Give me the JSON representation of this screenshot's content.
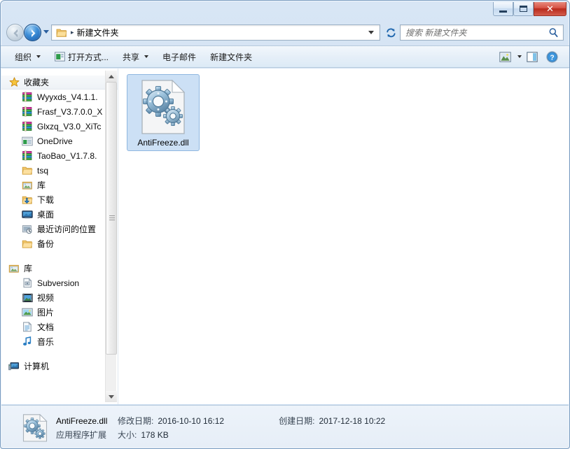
{
  "window": {
    "title": "",
    "controls": {
      "minimize": "minimize-button",
      "maximize": "maximize-button",
      "close": "✕"
    }
  },
  "nav": {
    "back_tooltip": "后退",
    "forward_tooltip": "前进",
    "breadcrumb": "新建文件夹",
    "breadcrumb_separator": "▸",
    "refresh_label": "刷新"
  },
  "search": {
    "placeholder": "搜索 新建文件夹",
    "value": ""
  },
  "toolbar": {
    "items": [
      {
        "label": "组织",
        "icon": "none",
        "caret": true
      },
      {
        "label": "打开方式...",
        "icon": "open-with-icon",
        "caret": false
      },
      {
        "label": "共享",
        "icon": "none",
        "caret": true
      },
      {
        "label": "电子邮件",
        "icon": "none",
        "caret": false
      },
      {
        "label": "新建文件夹",
        "icon": "none",
        "caret": false
      }
    ],
    "right_icons": [
      {
        "name": "view-icon",
        "caret": true
      },
      {
        "name": "preview-pane-icon",
        "caret": false
      },
      {
        "name": "help-icon",
        "caret": false
      }
    ]
  },
  "sidebar": {
    "sections": [
      {
        "header": {
          "label": "收藏夹",
          "icon": "star-icon"
        },
        "items": [
          {
            "label": "Wyyxds_V4.1.1.",
            "icon": "archive-icon"
          },
          {
            "label": "Frasf_V3.7.0.0_X",
            "icon": "archive-icon"
          },
          {
            "label": "Glxzq_V3.0_XiTc",
            "icon": "archive-icon"
          },
          {
            "label": "OneDrive",
            "icon": "onedrive-icon"
          },
          {
            "label": "TaoBao_V1.7.8.",
            "icon": "archive-icon"
          },
          {
            "label": "tsq",
            "icon": "folder-icon"
          },
          {
            "label": "库",
            "icon": "library-icon"
          },
          {
            "label": "下载",
            "icon": "downloads-icon"
          },
          {
            "label": "桌面",
            "icon": "desktop-icon"
          },
          {
            "label": "最近访问的位置",
            "icon": "recent-icon"
          },
          {
            "label": "备份",
            "icon": "folder-icon"
          }
        ]
      },
      {
        "header": {
          "label": "库",
          "icon": "library-icon"
        },
        "items": [
          {
            "label": "Subversion",
            "icon": "subversion-icon"
          },
          {
            "label": "视频",
            "icon": "video-icon"
          },
          {
            "label": "图片",
            "icon": "pictures-icon"
          },
          {
            "label": "文档",
            "icon": "documents-icon"
          },
          {
            "label": "音乐",
            "icon": "music-icon"
          }
        ]
      },
      {
        "header": {
          "label": "计算机",
          "icon": "computer-icon"
        },
        "items": []
      }
    ]
  },
  "files": [
    {
      "name": "AntiFreeze.dll",
      "icon": "dll-gears-icon",
      "selected": true
    }
  ],
  "details": {
    "file_name": "AntiFreeze.dll",
    "file_type": "应用程序扩展",
    "modified_label": "修改日期:",
    "modified_value": "2016-10-10 16:12",
    "created_label": "创建日期:",
    "created_value": "2017-12-18 10:22",
    "size_label": "大小:",
    "size_value": "178 KB"
  },
  "colors": {
    "selection": "#cce0f5",
    "selection_border": "#8fb7e0",
    "frame": "#cfe0f2",
    "close_button": "#b82a1c",
    "accent_blue": "#1356a8"
  }
}
